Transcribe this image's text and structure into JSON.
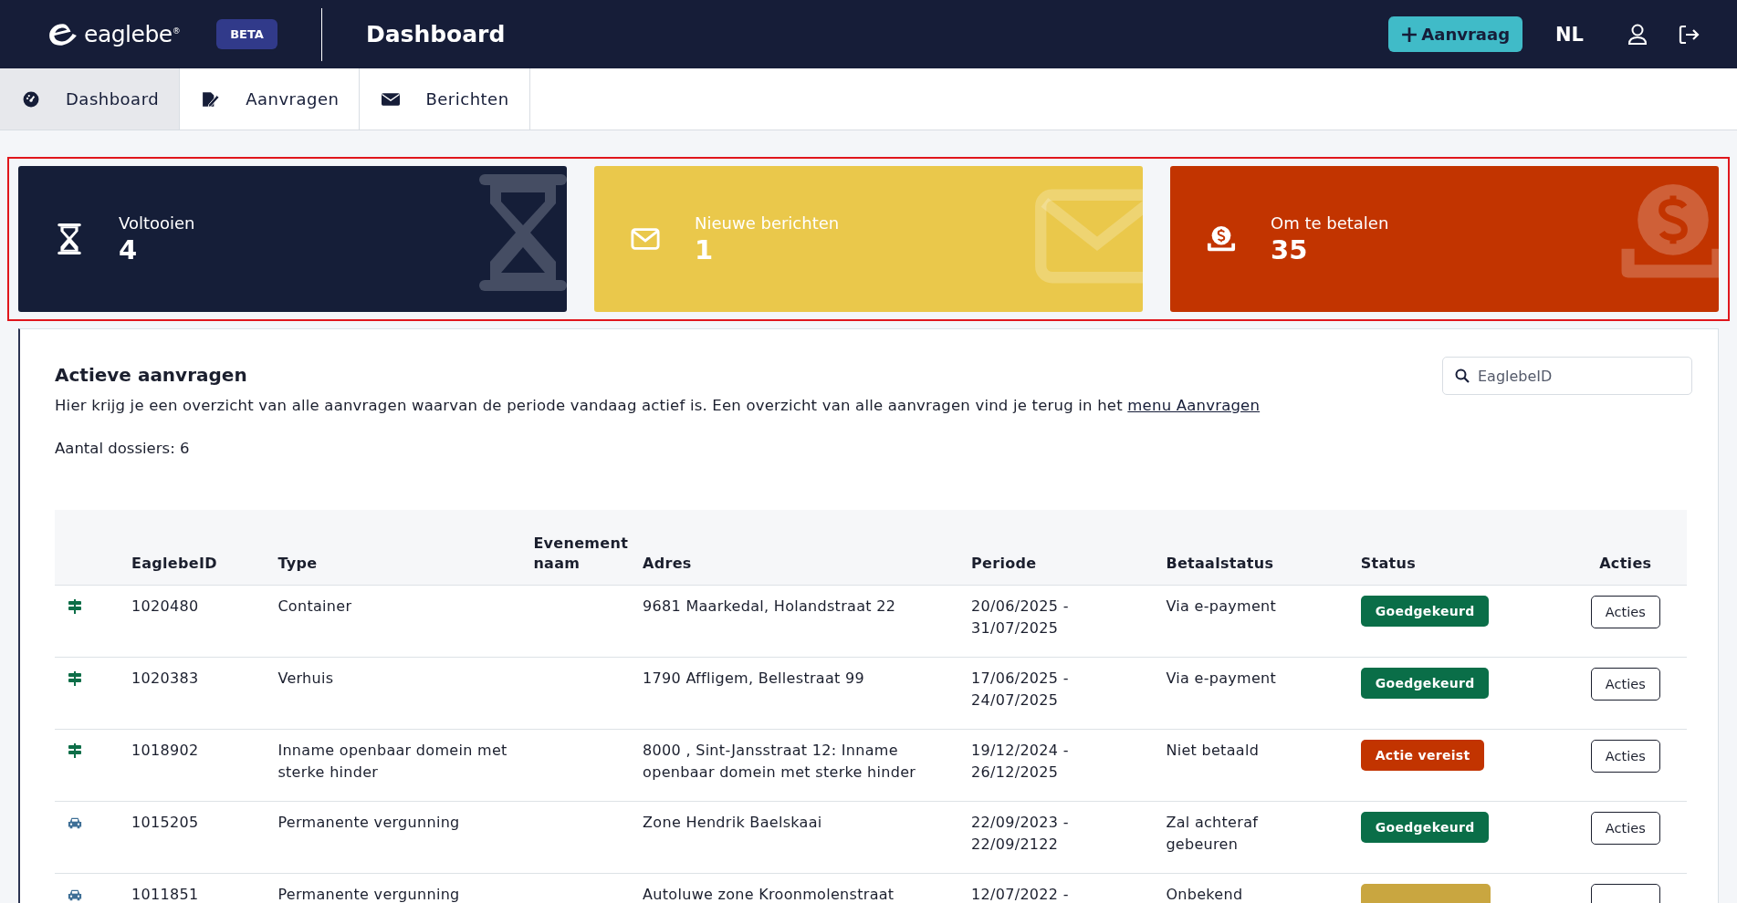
{
  "header": {
    "logo": "eaglebe",
    "logo_mark": "®",
    "badge": "BETA",
    "title": "Dashboard",
    "new_button": "Aanvraag",
    "language": "NL"
  },
  "nav": [
    {
      "label": "Dashboard",
      "kind": "dashboard",
      "selected": true
    },
    {
      "label": "Aanvragen",
      "kind": "requests",
      "selected": false
    },
    {
      "label": "Berichten",
      "kind": "messages",
      "selected": false
    }
  ],
  "stats": [
    {
      "kind": "complete",
      "label": "Voltooien",
      "value": "4"
    },
    {
      "kind": "messages",
      "label": "Nieuwe berichten",
      "value": "1"
    },
    {
      "kind": "pay",
      "label": "Om te betalen",
      "value": "35"
    }
  ],
  "panel": {
    "title": "Actieve aanvragen",
    "description": "Hier krijg je een overzicht van alle aanvragen waarvan de periode vandaag actief is. Een overzicht van alle aanvragen vind je terug in het",
    "link": "menu Aanvragen",
    "count": "Aantal dossiers: 6",
    "search": {
      "placeholder": "EaglebeID"
    }
  },
  "table": {
    "columns": [
      "EaglebeID",
      "Type",
      "Evenement naam",
      "Adres",
      "Periode",
      "Betaalstatus",
      "Status",
      "Acties"
    ],
    "rows": [
      {
        "kind": "signpost",
        "id": "1020480",
        "type": "Container",
        "address": "9681 Maarkedal, Holandstraat 22",
        "period": "20/06/2025 - 31/07/2025",
        "payment": "Via e-payment",
        "status": {
          "kind": "approved",
          "label": "Goedgekeurd"
        },
        "action": "Acties"
      },
      {
        "kind": "signpost",
        "id": "1020383",
        "type": "Verhuis",
        "address": "1790 Affligem, Bellestraat 99",
        "period": "17/06/2025 - 24/07/2025",
        "payment": "Via e-payment",
        "status": {
          "kind": "approved",
          "label": "Goedgekeurd"
        },
        "action": "Acties"
      },
      {
        "kind": "signpost",
        "id": "1018902",
        "type": "Inname openbaar domein met sterke hinder",
        "address": "8000 , Sint-Jansstraat 12: Inname openbaar domein met sterke hinder",
        "period": "19/12/2024 - 26/12/2025",
        "payment": "Niet betaald",
        "status": {
          "kind": "action",
          "label": "Actie vereist"
        },
        "action": "Acties"
      },
      {
        "kind": "car",
        "id": "1015205",
        "type": "Permanente vergunning",
        "address": "Zone Hendrik Baelskaai",
        "period": "22/09/2023 - 22/09/2122",
        "payment": "Zal achteraf gebeuren",
        "status": {
          "kind": "approved",
          "label": "Goedgekeurd"
        },
        "action": "Acties"
      },
      {
        "kind": "car",
        "id": "1011851",
        "type": "Permanente vergunning",
        "address": "Autoluwe zone Kroonmolenstraat",
        "period": "12/07/2022 -",
        "payment": "Onbekend",
        "status": {
          "kind": "pending"
        }
      }
    ]
  }
}
